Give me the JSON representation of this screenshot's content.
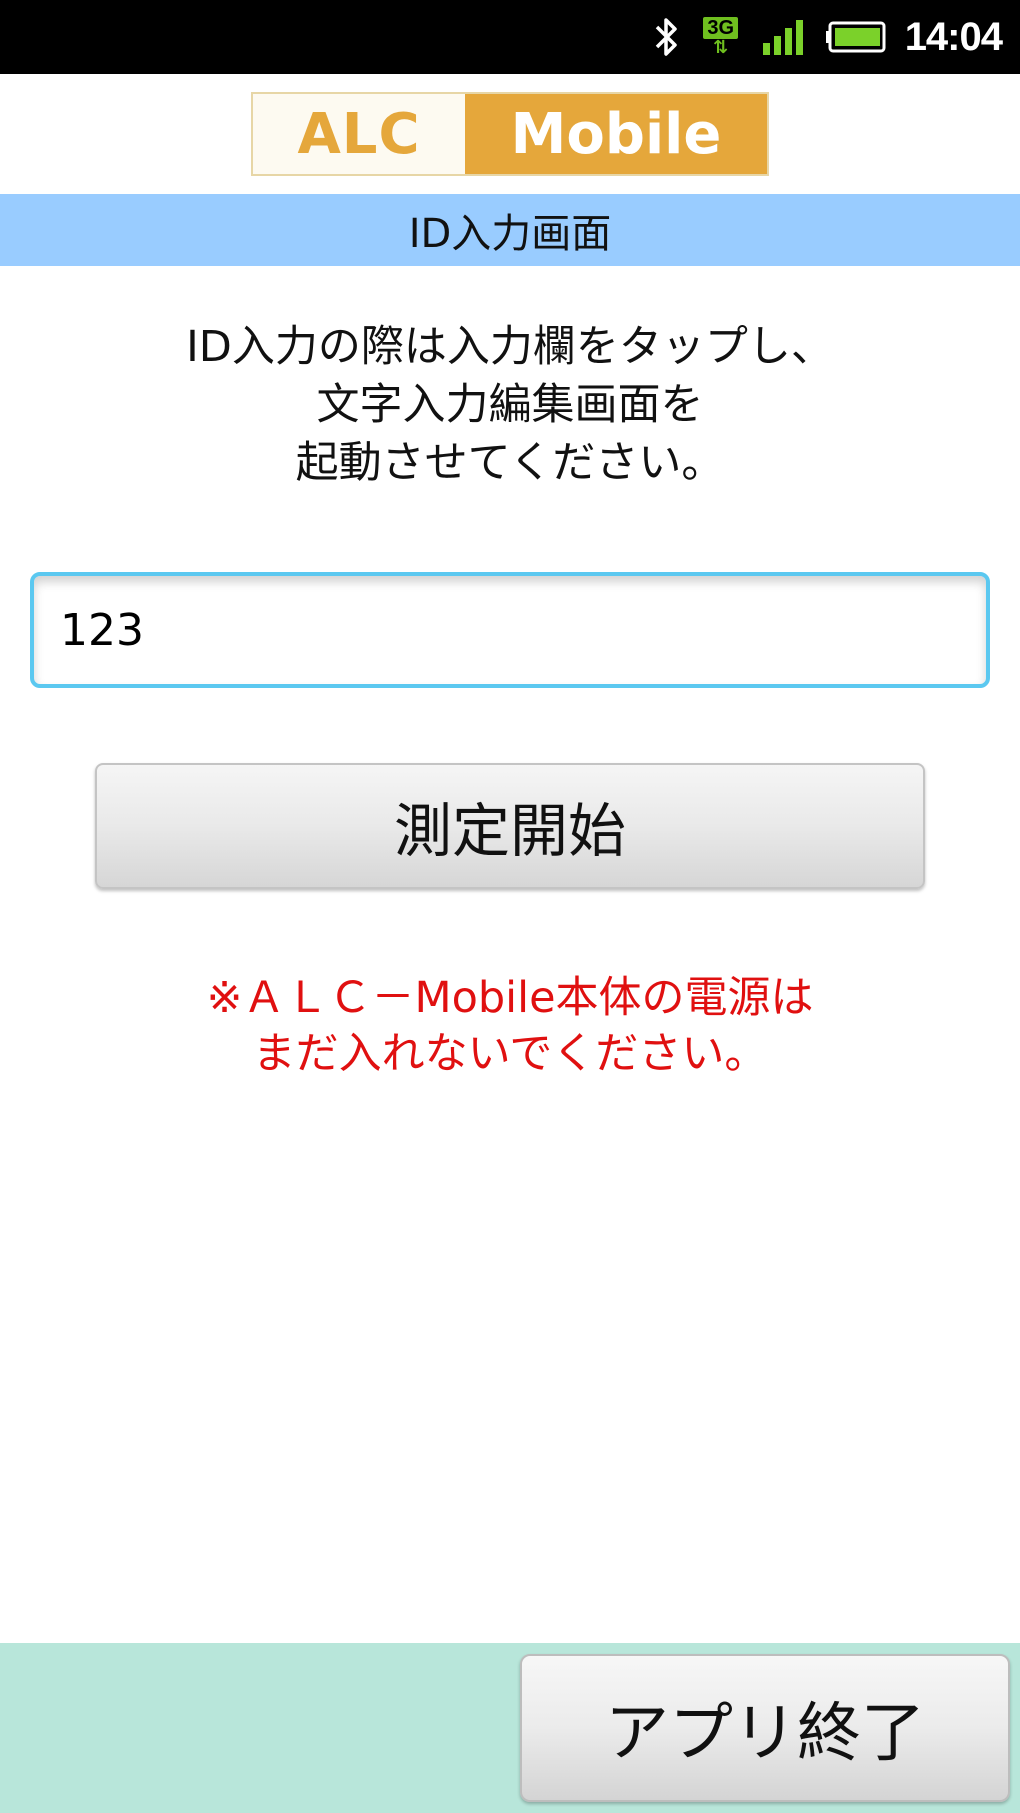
{
  "status_bar": {
    "time": "14:04",
    "network_type": "3G",
    "icons": [
      "bluetooth-icon",
      "3g-icon",
      "signal-icon",
      "battery-icon"
    ],
    "background": "#000000"
  },
  "logo": {
    "left_text": "ALC",
    "right_text": "Mobile",
    "accent_color": "#e5a73b"
  },
  "title_bar": {
    "title": "ID入力画面",
    "background": "#99ccff"
  },
  "instructions": {
    "line1": "ID入力の際は入力欄をタップし、",
    "line2": "文字入力編集画面を",
    "line3": "起動させてください。"
  },
  "id_field": {
    "value": "123",
    "border_color": "#5bc8f0"
  },
  "start_button": {
    "label": "測定開始"
  },
  "warning": {
    "line1": "※ＡＬＣ－Mobile本体の電源は",
    "line2": "まだ入れないでください。",
    "color": "#e01010"
  },
  "bottom_bar": {
    "exit_label": "アプリ終了",
    "background": "#b8e6da"
  }
}
